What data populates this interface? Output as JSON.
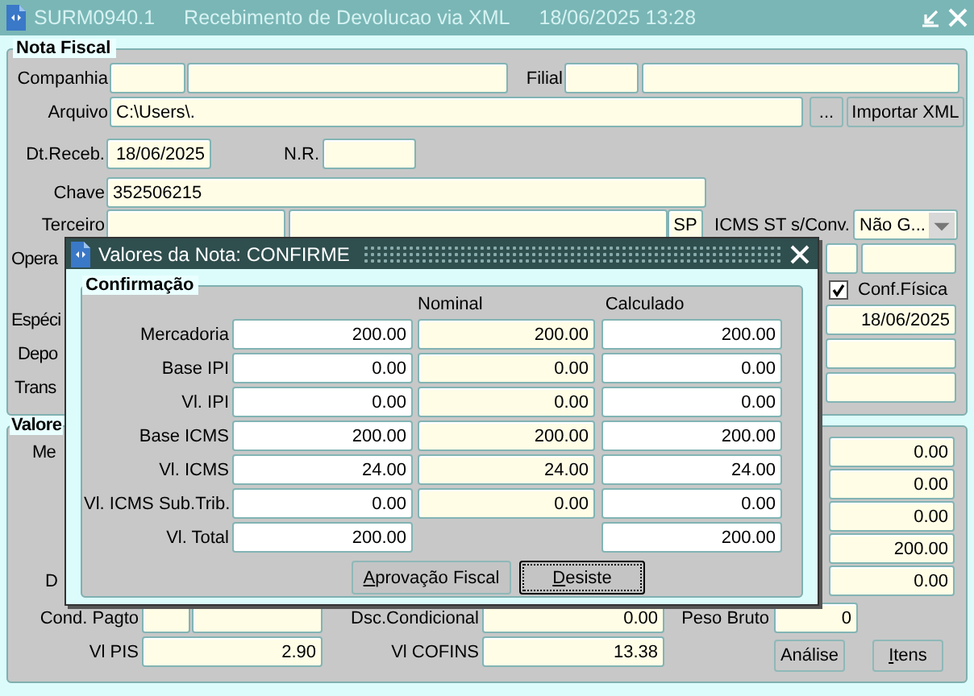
{
  "window": {
    "title": "SURM0940.1",
    "subtitle": "Recebimento de Devolucao via XML",
    "datetime": "18/06/2025 13:28"
  },
  "nota_fiscal": {
    "legend": "Nota Fiscal",
    "companhia_label": "Companhia",
    "filial_label": "Filial",
    "arquivo": {
      "label": "Arquivo",
      "value": "C:\\Users\\."
    },
    "browse_button": "...",
    "import_button": "Importar XML",
    "dt_receb": {
      "label": "Dt.Receb.",
      "value": "18/06/2025"
    },
    "nr_label": "N.R.",
    "chave": {
      "label": "Chave",
      "value": "352506215"
    },
    "terceiro": {
      "label": "Terceiro",
      "uf": "SP"
    },
    "icms_st": {
      "label": "ICMS ST s/Conv.",
      "value": "Não G..."
    },
    "operacao_label": "Opera",
    "conf_fisica": {
      "label": "Conf.Física",
      "checked": true
    },
    "especie": {
      "label": "Espéci",
      "date": "18/06/2025"
    },
    "deposito_label": "Depo",
    "transportadora_label": "Trans"
  },
  "valores": {
    "legend": "Valore",
    "labels": [
      "Me",
      "D"
    ],
    "right_values": [
      "0.00",
      "0.00",
      "0.00",
      "200.00",
      "0.00"
    ],
    "cond_pagto_label": "Cond. Pagto",
    "dsc_condicional": {
      "label": "Dsc.Condicional",
      "value": "0.00"
    },
    "peso_bruto": {
      "label": "Peso Bruto",
      "value": "0"
    },
    "vl_pis": {
      "label": "Vl PIS",
      "value": "2.90"
    },
    "vl_cofins": {
      "label": "Vl COFINS",
      "value": "13.38"
    },
    "buttons": [
      {
        "label": "Análise",
        "mnemonic": false
      },
      {
        "label": "Itens",
        "mnemonic": true
      }
    ]
  },
  "dialog": {
    "title": "Valores da Nota: CONFIRME",
    "legend": "Confirmação",
    "columns": [
      "Nominal",
      "Calculado"
    ],
    "rows": [
      {
        "label": "Mercadoria",
        "kind": "full",
        "values": [
          "200.00",
          "200.00",
          "200.00"
        ]
      },
      {
        "label": "Base IPI",
        "kind": "full",
        "values": [
          "0.00",
          "0.00",
          "0.00"
        ]
      },
      {
        "label": "Vl. IPI",
        "kind": "full",
        "values": [
          "0.00",
          "0.00",
          "0.00"
        ]
      },
      {
        "label": "Base ICMS",
        "kind": "full",
        "values": [
          "200.00",
          "200.00",
          "200.00"
        ]
      },
      {
        "label": "Vl. ICMS",
        "kind": "full",
        "values": [
          "24.00",
          "24.00",
          "24.00"
        ]
      },
      {
        "label": "Vl. ICMS Sub.Trib.",
        "kind": "full",
        "values": [
          "0.00",
          "0.00",
          "0.00"
        ]
      },
      {
        "label": "Vl. Total",
        "kind": "total",
        "values": [
          "200.00",
          "200.00"
        ]
      }
    ],
    "buttons": [
      {
        "label": "Aprovação Fiscal",
        "mnemonic": true,
        "focused": false
      },
      {
        "label": "Desiste",
        "mnemonic": true,
        "focused": true
      }
    ]
  }
}
